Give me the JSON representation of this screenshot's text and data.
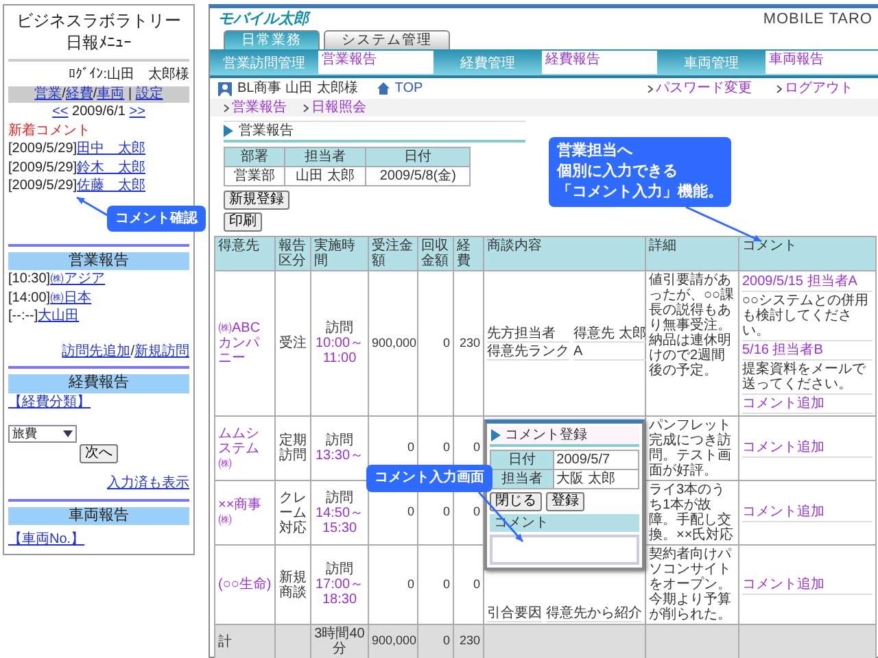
{
  "phone": {
    "title": [
      "ビジネスラボラトリー",
      "日報ﾒﾆｭｰ"
    ],
    "login": "ﾛｸﾞｲﾝ:山田　太郎様",
    "menu_links": [
      "営業",
      "経費",
      "車両"
    ],
    "separator": "/",
    "settings_separator": "|",
    "settings_link": "設定",
    "date_nav": {
      "prev": "<<",
      "date": "2009/6/1",
      "next": ">>"
    },
    "new_comments": {
      "title": "新着コメント",
      "items": [
        {
          "date": "[2009/5/29]",
          "name": "田中　太郎"
        },
        {
          "date": "[2009/5/29]",
          "name": "鈴木　太郎"
        },
        {
          "date": "[2009/5/29]",
          "name": "佐藤　太郎"
        }
      ]
    },
    "sales": {
      "title": "営業報告",
      "visits": [
        {
          "time": "[10:30]",
          "customer": "㈱アジア"
        },
        {
          "time": "[14:00]",
          "customer": "㈱日本"
        },
        {
          "time": "[--:--]",
          "customer": "大山田"
        }
      ],
      "add_link": "訪問先追加",
      "link_separator": "/",
      "new_link": "新規訪問"
    },
    "expenses": {
      "title": "経費報告",
      "category_link": "【経費分類】",
      "select": "旅費",
      "next_button": "次へ",
      "show_done_link": "入力済も表示"
    },
    "vehicles": {
      "title": "車両報告",
      "number_link": "【車両No.】"
    }
  },
  "app": {
    "logo": "モバイル太郎",
    "brand": "MOBILE TARO",
    "tabs": [
      {
        "label": "日常業務",
        "selected": true
      },
      {
        "label": "システム管理",
        "selected": false
      }
    ],
    "menu_groups": [
      {
        "title": "営業訪問管理",
        "link": "営業報告"
      },
      {
        "title": "経費管理",
        "link": "経費報告"
      },
      {
        "title": "車両管理",
        "link": "車両報告"
      }
    ],
    "user": "BL商事 山田 太郎様",
    "top_link": "TOP",
    "account_links": [
      "パスワード変更",
      "ログアウト"
    ],
    "breadcrumbs": [
      "営業報告",
      "日報照会"
    ],
    "section_title": "営業報告",
    "summary": {
      "columns": [
        "部署",
        "担当者",
        "日付"
      ],
      "values": [
        "営業部",
        "山田 太郎",
        "2009/5/8(金)"
      ]
    },
    "buttons": [
      "新規登録",
      "印刷"
    ],
    "table": {
      "columns": [
        "得意先",
        "報告区分",
        "実施時間",
        "受注金額",
        "回収金額",
        "経費",
        "商談内容",
        "詳細",
        "コメント"
      ],
      "rows": [
        {
          "customer": "㈱ABCカンパニー",
          "type": "受注",
          "visit": "訪問",
          "time": "10:00～11:00",
          "order": "900,000",
          "collected": "0",
          "expense": "230",
          "meeting": [
            {
              "label": "先方担当者",
              "value": "得意先 太郎"
            },
            {
              "label": "得意先ランク",
              "value": "A"
            }
          ],
          "detail": "値引要請があったが、○○課長の説得もあり無事受注。納品は連休明けので2週間後の予定。",
          "comments": [
            {
              "head": "2009/5/15 担当者A",
              "text": "○○システムとの併用も検討してください。"
            },
            {
              "head": "5/16 担当者B",
              "text": "提案資料をメールで送ってください。"
            }
          ],
          "add_link": "コメント追加"
        },
        {
          "customer": "ムムシステム㈱",
          "type": "定期訪問",
          "visit": "訪問",
          "time": "13:30～",
          "order": "0",
          "collected": "0",
          "expense": "0",
          "meeting": [],
          "detail": "パンフレット完成につき訪問。テスト画面が好評。",
          "comments": [],
          "add_link": "コメント追加"
        },
        {
          "customer": "××商事㈱",
          "type": "クレーム対応",
          "visit": "訪問",
          "time": "14:50～15:30",
          "order": "0",
          "collected": "0",
          "expense": "0",
          "meeting": [],
          "detail": "ライ3本のうち1本が故障。手配し交換。××氏対応",
          "comments": [],
          "add_link": "コメント追加"
        },
        {
          "customer": "(○○生命)",
          "type": "新規商談",
          "visit": "訪問",
          "time": "17:00～18:30",
          "order": "0",
          "collected": "0",
          "expense": "0",
          "meeting": [
            {
              "label": "引合要因",
              "value": "得意先から紹介"
            }
          ],
          "detail": "契約者向けパソコンサイトをオープン。今期より予算が削られた。",
          "comments": [],
          "add_link": "コメント追加"
        }
      ],
      "total": {
        "label": "計",
        "time": "3時間40分",
        "order": "900,000",
        "collected": "0",
        "expense": "230"
      }
    },
    "dialog": {
      "title": "コメント登録",
      "fields": [
        {
          "label": "日付",
          "value": "2009/5/7"
        },
        {
          "label": "担当者",
          "value": "大阪 太郎"
        }
      ],
      "buttons": [
        "閉じる",
        "登録"
      ],
      "comment_label": "コメント"
    }
  },
  "callouts": [
    {
      "lines": [
        "コメント確認"
      ]
    },
    {
      "lines": [
        "営業担当へ",
        "個別に入力できる",
        "「コメント入力」機能。"
      ]
    },
    {
      "lines": [
        "コメント入力画面"
      ]
    }
  ]
}
